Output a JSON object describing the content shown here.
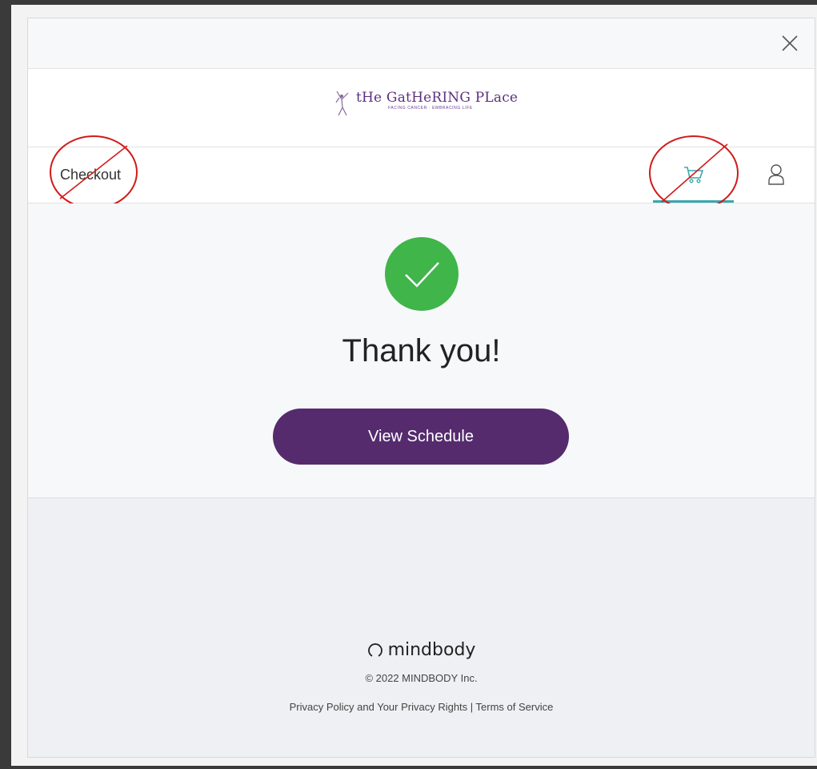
{
  "brand": {
    "name": "tHe GatHeRING PLace",
    "tagline": "FACING CANCER · EMBRACING LIFE",
    "color": "#5b2f7f"
  },
  "nav": {
    "checkout_label": "Checkout",
    "cart_icon": "cart-icon",
    "user_icon": "user-icon",
    "active_tab_color": "#3aa7b0"
  },
  "confirmation": {
    "icon": "checkmark-icon",
    "icon_color": "#3fb54a",
    "message": "Thank you!",
    "button_label": "View Schedule",
    "button_color": "#552b6e"
  },
  "footer": {
    "logo_text": "mindbody",
    "copyright": "© 2022 MINDBODY Inc.",
    "privacy_link": "Privacy Policy and Your Privacy Rights",
    "separator": " | ",
    "terms_link": "Terms of Service"
  },
  "annotations": {
    "color": "#d11a1a"
  }
}
